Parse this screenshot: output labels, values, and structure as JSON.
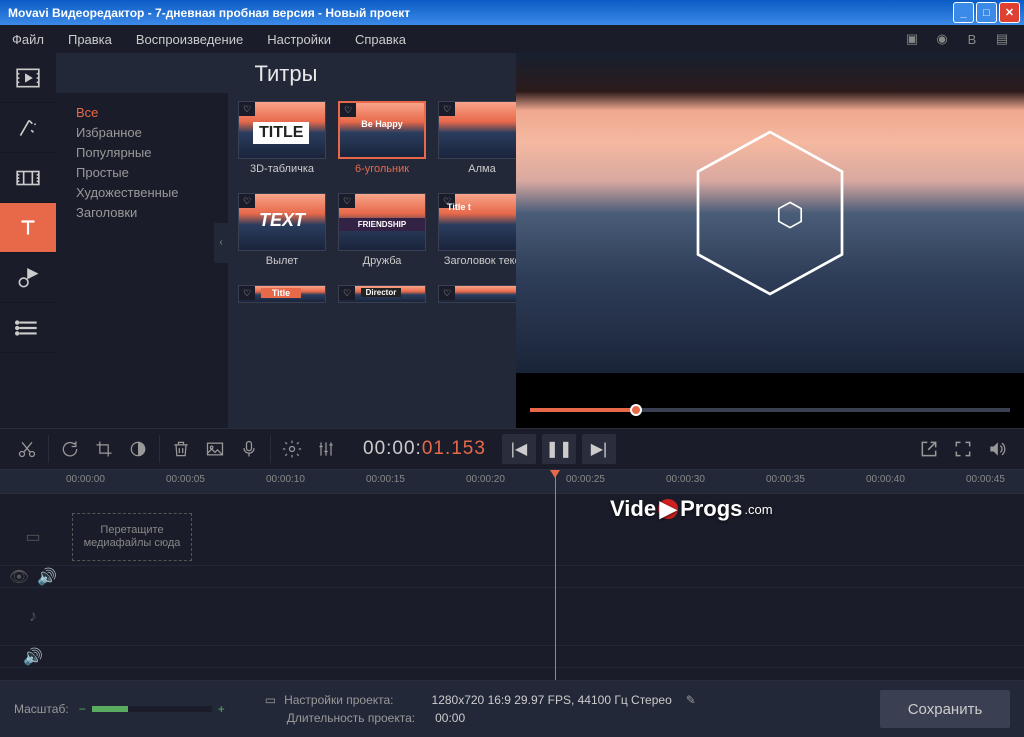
{
  "titlebar": "Movavi Видеоредактор - 7-дневная пробная версия - Новый проект",
  "menu": {
    "file": "Файл",
    "edit": "Правка",
    "play": "Воспроизведение",
    "settings": "Настройки",
    "help": "Справка"
  },
  "panel": {
    "title": "Титры",
    "categories": [
      "Все",
      "Избранное",
      "Популярные",
      "Простые",
      "Художественные",
      "Заголовки"
    ],
    "tiles": {
      "r1": [
        {
          "thumb": "TITLE",
          "caption": "3D-табличка"
        },
        {
          "thumb": "Be Happy",
          "caption": "6-угольник",
          "selected": true
        },
        {
          "thumb": "",
          "caption": "Алма"
        }
      ],
      "r2": [
        {
          "thumb": "TEXT",
          "caption": "Вылет"
        },
        {
          "thumb": "FRIENDSHIP",
          "caption": "Дружба"
        },
        {
          "thumb": "Title t",
          "caption": "Заголовок текс"
        }
      ],
      "r3": [
        {
          "thumb": "Title",
          "caption": ""
        },
        {
          "thumb": "Director",
          "caption": ""
        },
        {
          "thumb": "",
          "caption": ""
        }
      ]
    }
  },
  "timecode": {
    "a": "00:00:",
    "b": "01.153"
  },
  "ruler": [
    "00:00:00",
    "00:00:05",
    "00:00:10",
    "00:00:15",
    "00:00:20",
    "00:00:25",
    "00:00:30",
    "00:00:35",
    "00:00:40",
    "00:00:45"
  ],
  "dropzone": "Перетащите медиафайлы сюда",
  "watermark": {
    "a": "Vide",
    "b": "Progs",
    "c": ".com"
  },
  "footer": {
    "zoom_label": "Масштаб:",
    "proj_label": "Настройки проекта:",
    "proj_value": "1280x720 16:9 29.97 FPS, 44100 Гц Стерео",
    "dur_label": "Длительность проекта:",
    "dur_value": "00:00",
    "save": "Сохранить"
  }
}
